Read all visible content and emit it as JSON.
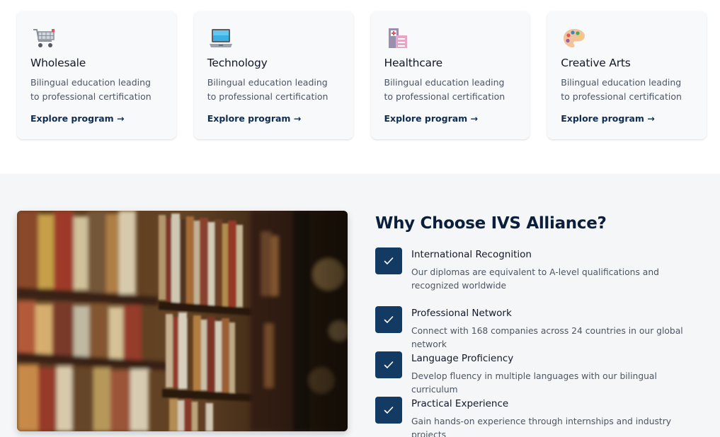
{
  "programs": [
    {
      "title": "Wholesale",
      "description": "Bilingual education leading to professional certification",
      "link": "Explore program →",
      "icon": "shopping-cart-icon"
    },
    {
      "title": "Technology",
      "description": "Bilingual education leading to professional certification",
      "link": "Explore program →",
      "icon": "laptop-icon"
    },
    {
      "title": "Healthcare",
      "description": "Bilingual education leading to professional certification",
      "link": "Explore program →",
      "icon": "hospital-icon"
    },
    {
      "title": "Creative Arts",
      "description": "Bilingual education leading to professional certification",
      "link": "Explore program →",
      "icon": "palette-icon"
    }
  ],
  "why": {
    "title": "Why Choose IVS Alliance?",
    "image": "library-bookshelf-photo",
    "features": [
      {
        "title": "International Recognition",
        "description": "Our diplomas are equivalent to A-level qualifications and recognized worldwide",
        "icon": "check-icon"
      },
      {
        "title": "Professional Network",
        "description": "Connect with 168 companies across 24 countries in our global network",
        "icon": "check-icon"
      },
      {
        "title": "Language Proficiency",
        "description": "Develop fluency in multiple languages with our bilingual curriculum",
        "icon": "check-icon"
      },
      {
        "title": "Practical Experience",
        "description": "Gain hands-on experience through internships and industry projects",
        "icon": "check-icon"
      }
    ]
  },
  "colors": {
    "accent": "#123a63",
    "link": "#0f2d52",
    "section_bg": "#f5f6f8",
    "card_bg": "#f8f9fa"
  }
}
